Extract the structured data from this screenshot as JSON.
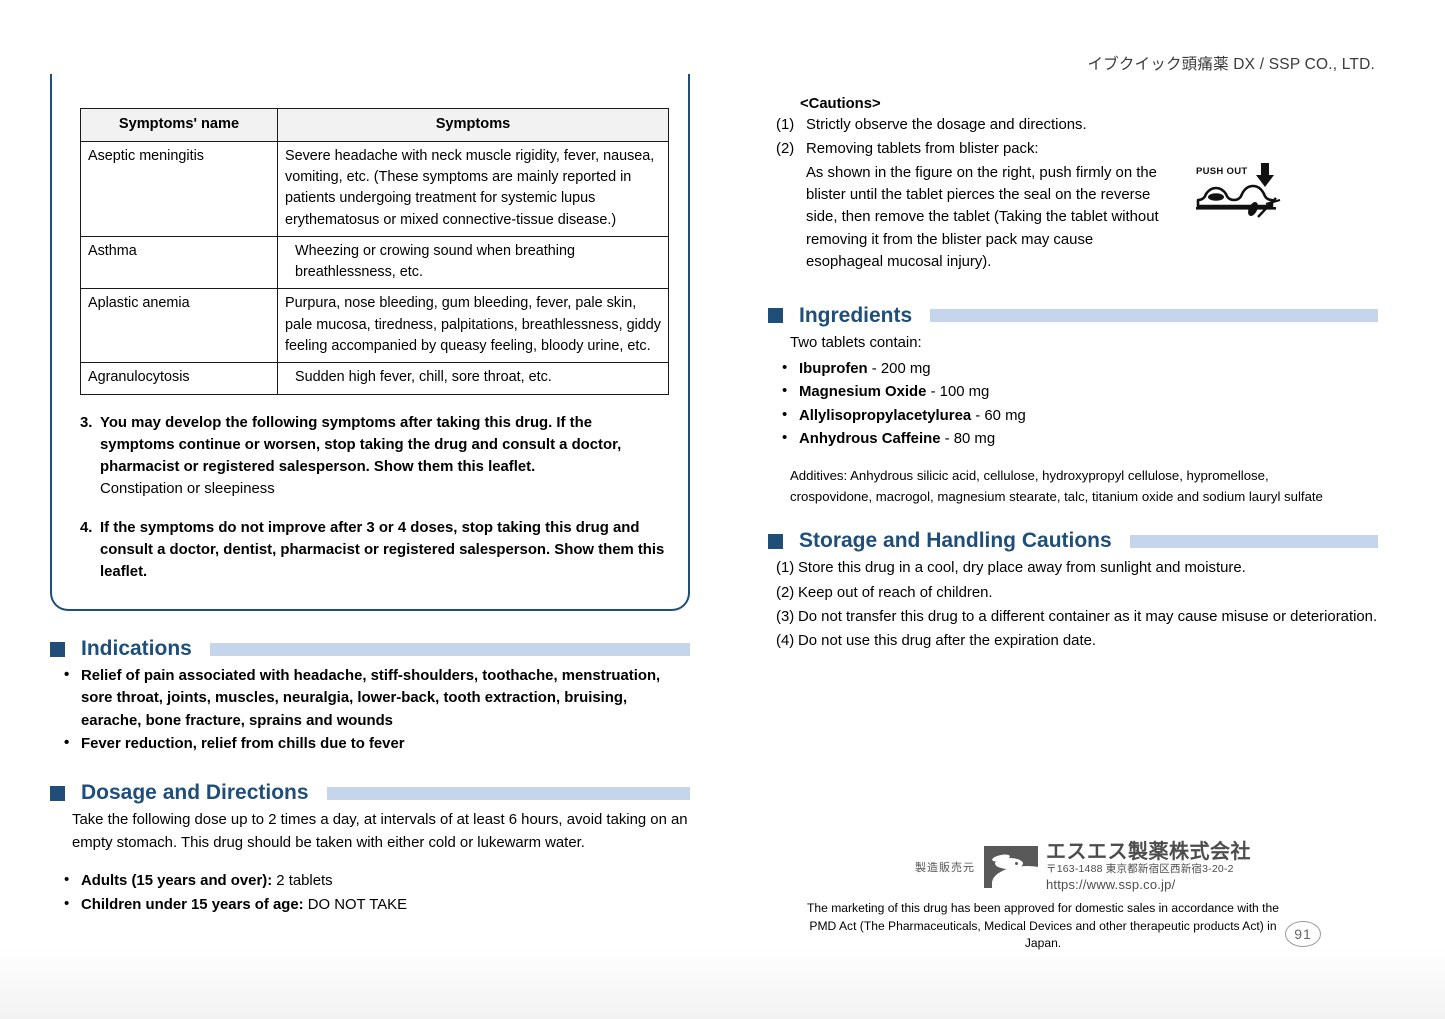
{
  "header": {
    "product_line": "イブクイック頭痛薬 DX / SSP CO., LTD."
  },
  "symptom_table": {
    "columns": [
      "Symptoms' name",
      "Symptoms"
    ],
    "rows": [
      {
        "name": "Aseptic meningitis",
        "desc": "Severe headache with neck muscle rigidity, fever, nausea, vomiting, etc. (These symptoms are mainly reported in patients undergoing treatment for systemic lupus erythematosus or mixed connective-tissue disease.)"
      },
      {
        "name": "Asthma",
        "desc": "Wheezing or crowing sound when breathing breathlessness, etc."
      },
      {
        "name": "Aplastic anemia",
        "desc": "Purpura, nose bleeding, gum bleeding, fever, pale skin, pale mucosa, tiredness, palpitations, breathlessness, giddy feeling accompanied by queasy feeling, bloody urine, etc."
      },
      {
        "name": "Agranulocytosis",
        "desc": "Sudden high fever, chill, sore throat, etc."
      }
    ]
  },
  "warnings": [
    {
      "num": "3.",
      "bold_text": "You may develop the following symptoms after taking this drug. If the symptoms continue or worsen, stop taking the drug and consult a doctor, pharmacist or registered salesperson. Show them this leaflet.",
      "plain_text": "Constipation or sleepiness"
    },
    {
      "num": "4.",
      "bold_text": "If the symptoms do not improve after 3 or 4 doses, stop taking this drug and consult a doctor, dentist, pharmacist or registered salesperson. Show them this leaflet.",
      "plain_text": ""
    }
  ],
  "indications": {
    "title": "Indications",
    "items": [
      "Relief of pain associated with headache, stiff-shoulders, toothache, menstruation, sore throat, joints, muscles, neuralgia, lower-back, tooth extraction, bruising, earache, bone fracture, sprains and wounds",
      "Fever reduction, relief from chills due to fever"
    ]
  },
  "dosage": {
    "title": "Dosage and Directions",
    "intro": "Take the following dose up to 2 times a day, at intervals of at least 6 hours, avoid taking on an empty stomach. This drug should be taken with either cold or lukewarm water.",
    "items": [
      {
        "label": "Adults (15 years and over):",
        "value": " 2 tablets"
      },
      {
        "label": "Children under 15 years of age:",
        "value": " DO NOT TAKE"
      }
    ]
  },
  "cautions": {
    "title": "<Cautions>",
    "items": [
      {
        "num": "(1)",
        "text": "Strictly observe the dosage and directions.",
        "sub": ""
      },
      {
        "num": "(2)",
        "text": "Removing tablets from blister pack:",
        "sub": "As shown in the figure on the right, push firmly on the blister until the tablet pierces the seal on the reverse side, then remove the tablet (Taking the tablet without removing it from the blister pack may cause esophageal mucosal injury)."
      }
    ],
    "figure_label": "PUSH OUT"
  },
  "ingredients": {
    "title": "Ingredients",
    "intro": "Two tablets contain:",
    "items": [
      {
        "name": "Ibuprofen",
        "amount": " - 200 mg"
      },
      {
        "name": "Magnesium Oxide",
        "amount": " - 100 mg"
      },
      {
        "name": "Allylisopropylacetylurea",
        "amount": " - 60 mg"
      },
      {
        "name": "Anhydrous Caffeine",
        "amount": " - 80 mg"
      }
    ],
    "additives": "Additives: Anhydrous silicic acid, cellulose, hydroxypropyl cellulose, hypromellose, crospovidone, macrogol, magnesium stearate, talc, titanium oxide and sodium lauryl sulfate"
  },
  "storage": {
    "title": "Storage and Handling Cautions",
    "items": [
      {
        "num": "(1)",
        "text": "Store this drug in a cool, dry place away from sunlight and moisture."
      },
      {
        "num": "(2)",
        "text": "Keep out of reach of children."
      },
      {
        "num": "(3)",
        "text": "Do not transfer this drug to a different container as it may cause misuse or deterioration."
      },
      {
        "num": "(4)",
        "text": "Do not use this drug after the expiration date."
      }
    ]
  },
  "footer": {
    "manufacturer_label": "製造販売元",
    "company_name": "エスエス製薬株式会社",
    "company_address": "〒163-1488 東京都新宿区西新宿3-20-2",
    "company_url": "https://www.ssp.co.jp/",
    "approval_note": "The marketing of this drug has been approved for domestic sales in accordance with the PMD Act (The Pharmaceuticals, Medical Devices and other therapeutic products Act) in Japan.",
    "page_number": "91"
  },
  "colors": {
    "navy": "#1F4E79",
    "accent_bar": "#C5D5EC",
    "table_header_bg": "#F2F2F2"
  }
}
